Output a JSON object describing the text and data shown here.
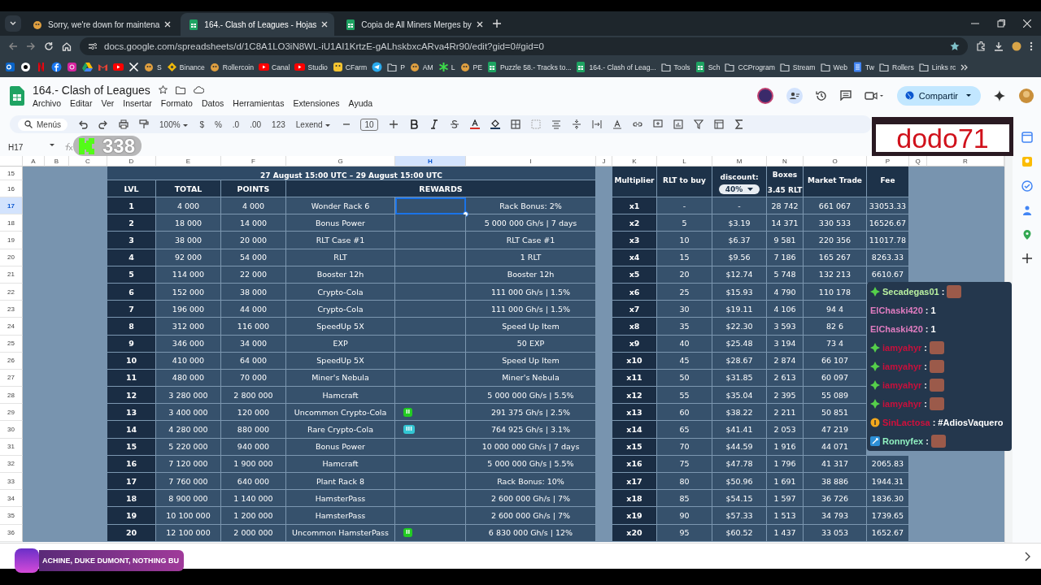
{
  "browser": {
    "tabs": [
      {
        "title": "Sorry, we're down for maintena",
        "kind": "mascot",
        "selected": false
      },
      {
        "title": "164.- Clash of Leagues - Hojas",
        "kind": "sheet",
        "selected": true
      },
      {
        "title": "Copia de All Miners Merges by",
        "kind": "sheet",
        "selected": false
      }
    ],
    "url": "docs.google.com/spreadsheets/d/1C8A1LO3iN8WL-iU1AI1KrtzE-gALhskbxcARva4Rr90/edit?gid=0#gid=0",
    "bookmarks": [
      {
        "kind": "outlook"
      },
      {
        "kind": "ring"
      },
      {
        "kind": "netflix"
      },
      {
        "kind": "facebook"
      },
      {
        "kind": "instagram"
      },
      {
        "kind": "drive"
      },
      {
        "kind": "gmail"
      },
      {
        "kind": "youtube"
      },
      {
        "kind": "x"
      },
      {
        "kind": "mascot",
        "label": "S"
      },
      {
        "kind": "diamond",
        "label": "Binance"
      },
      {
        "kind": "mascot",
        "label": "Rollercoin"
      },
      {
        "kind": "youtube",
        "label": "Canal"
      },
      {
        "kind": "youtube",
        "label": "Studio"
      },
      {
        "kind": "face",
        "label": "CFarm"
      },
      {
        "kind": "telegram"
      },
      {
        "kind": "folder",
        "label": "P"
      },
      {
        "kind": "mascot",
        "label": "AM"
      },
      {
        "kind": "star",
        "label": "L"
      },
      {
        "kind": "mascot",
        "label": "PE"
      },
      {
        "kind": "sheet",
        "label": "Puzzle 58.- Tracks to..."
      },
      {
        "kind": "sheet",
        "label": "164.- Clash of Leag..."
      },
      {
        "kind": "folder",
        "label": "Tools"
      },
      {
        "kind": "sheet",
        "label": "Sch"
      },
      {
        "kind": "folder",
        "label": "CCProgram"
      },
      {
        "kind": "folder",
        "label": "Stream"
      },
      {
        "kind": "folder",
        "label": "Web"
      },
      {
        "kind": "doc",
        "label": "Tw"
      },
      {
        "kind": "folder",
        "label": "Rollers"
      },
      {
        "kind": "folder",
        "label": "Links rc"
      }
    ]
  },
  "sheets": {
    "title": "164.- Clash of Leagues",
    "menus": [
      "Archivo",
      "Editar",
      "Ver",
      "Insertar",
      "Formato",
      "Datos",
      "Herramientas",
      "Extensiones",
      "Ayuda"
    ],
    "share_button": "Compartir",
    "search_menus": "Menús",
    "zoom": "100%",
    "currency": "$",
    "percent": "%",
    "decrease_decimals": ".0",
    "increase_decimals": ".00",
    "number_format": "123",
    "font": "Lexend",
    "font_size": "10",
    "cell_ref": "H17",
    "columns": [
      {
        "letter": "A",
        "selected": false
      },
      {
        "letter": "B",
        "selected": false
      },
      {
        "letter": "C",
        "selected": false
      },
      {
        "letter": "D",
        "selected": false
      },
      {
        "letter": "E",
        "selected": false
      },
      {
        "letter": "F",
        "selected": false
      },
      {
        "letter": "G",
        "selected": false
      },
      {
        "letter": "H",
        "selected": true
      },
      {
        "letter": "I",
        "selected": false
      },
      {
        "letter": "J",
        "selected": false
      },
      {
        "letter": "K",
        "selected": false
      },
      {
        "letter": "L",
        "selected": false
      },
      {
        "letter": "M",
        "selected": false
      },
      {
        "letter": "N",
        "selected": false
      },
      {
        "letter": "O",
        "selected": false
      },
      {
        "letter": "P",
        "selected": false
      },
      {
        "letter": "Q",
        "selected": false
      },
      {
        "letter": "R",
        "selected": false
      }
    ],
    "row_numbers": [
      {
        "label": "15",
        "selected": false
      },
      {
        "label": "16",
        "selected": false
      },
      {
        "label": "17",
        "selected": true
      },
      {
        "label": "18",
        "selected": false
      },
      {
        "label": "19",
        "selected": false
      },
      {
        "label": "20",
        "selected": false
      },
      {
        "label": "21",
        "selected": false
      },
      {
        "label": "22",
        "selected": false
      },
      {
        "label": "23",
        "selected": false
      },
      {
        "label": "24",
        "selected": false
      },
      {
        "label": "25",
        "selected": false
      },
      {
        "label": "26",
        "selected": false
      },
      {
        "label": "27",
        "selected": false
      },
      {
        "label": "28",
        "selected": false
      },
      {
        "label": "29",
        "selected": false
      },
      {
        "label": "30",
        "selected": false
      },
      {
        "label": "31",
        "selected": false
      },
      {
        "label": "32",
        "selected": false
      },
      {
        "label": "33",
        "selected": false
      },
      {
        "label": "34",
        "selected": false
      },
      {
        "label": "35",
        "selected": false
      },
      {
        "label": "36",
        "selected": false
      }
    ]
  },
  "levels_table": {
    "title": "27 August 15:00 UTC – 29 August 15:00 UTC",
    "headers": [
      "LVL",
      "TOTAL",
      "POINTS",
      "REWARDS"
    ],
    "rows": [
      {
        "lvl": "1",
        "total": "4 000",
        "points": "4 000",
        "reward": "Wonder Rack 6",
        "detail": "Rack Bonus: 2%",
        "selected": true
      },
      {
        "lvl": "2",
        "total": "18 000",
        "points": "14 000",
        "reward": "Bonus Power",
        "detail": "5 000 000 Gh/s | 7 days",
        "selected": false
      },
      {
        "lvl": "3",
        "total": "38 000",
        "points": "20 000",
        "reward": "RLT Case #1",
        "detail": "RLT Case #1",
        "selected": false
      },
      {
        "lvl": "4",
        "total": "92 000",
        "points": "54 000",
        "reward": "RLT",
        "detail": "1 RLT",
        "selected": false
      },
      {
        "lvl": "5",
        "total": "114 000",
        "points": "22 000",
        "reward": "Booster 12h",
        "detail": "Booster 12h",
        "selected": false
      },
      {
        "lvl": "6",
        "total": "152 000",
        "points": "38 000",
        "reward": "Crypto-Cola",
        "detail": "111 000 Gh/s  |  1.5%",
        "selected": false
      },
      {
        "lvl": "7",
        "total": "196 000",
        "points": "44 000",
        "reward": "Crypto-Cola",
        "detail": "111 000 Gh/s  |  1.5%",
        "selected": false
      },
      {
        "lvl": "8",
        "total": "312 000",
        "points": "116 000",
        "reward": "SpeedUp 5X",
        "detail": "Speed Up Item",
        "selected": false
      },
      {
        "lvl": "9",
        "total": "346 000",
        "points": "34 000",
        "reward": "EXP",
        "detail": "50 EXP",
        "selected": false
      },
      {
        "lvl": "10",
        "total": "410 000",
        "points": "64 000",
        "reward": "SpeedUp 5X",
        "detail": "Speed Up Item",
        "selected": false
      },
      {
        "lvl": "11",
        "total": "480 000",
        "points": "70 000",
        "reward": "Miner's Nebula",
        "detail": "Miner's Nebula",
        "selected": false
      },
      {
        "lvl": "12",
        "total": "3 280 000",
        "points": "2 800 000",
        "reward": "Hamcraft",
        "detail": "5 000 000 Gh/s  |  5.5%",
        "selected": false
      },
      {
        "lvl": "13",
        "total": "3 400 000",
        "points": "120 000",
        "reward": "Uncommon Crypto-Cola",
        "badge": {
          "label": "II",
          "color": "#22cc22"
        },
        "detail": "291 375 Gh/s  |  2.5%",
        "selected": false
      },
      {
        "lvl": "14",
        "total": "4 280 000",
        "points": "880 000",
        "reward": "Rare Crypto-Cola",
        "badge": {
          "label": "III",
          "color": "#33c6d3"
        },
        "detail": "764 925 Gh/s  |  3.1%",
        "selected": false
      },
      {
        "lvl": "15",
        "total": "5 220 000",
        "points": "940 000",
        "reward": "Bonus Power",
        "detail": "10 000 000 Gh/s | 7 days",
        "selected": false
      },
      {
        "lvl": "16",
        "total": "7 120 000",
        "points": "1 900 000",
        "reward": "Hamcraft",
        "detail": "5 000 000 Gh/s  |  5.5%",
        "selected": false
      },
      {
        "lvl": "17",
        "total": "7 760 000",
        "points": "640 000",
        "reward": "Plant Rack 8",
        "detail": "Rack Bonus: 10%",
        "selected": false
      },
      {
        "lvl": "18",
        "total": "8 900 000",
        "points": "1 140 000",
        "reward": "HamsterPass",
        "detail": "2 600 000 Gh/s  |  7%",
        "selected": false
      },
      {
        "lvl": "19",
        "total": "10 100 000",
        "points": "1 200 000",
        "reward": "HamsterPass",
        "detail": "2 600 000 Gh/s  |  7%",
        "selected": false
      },
      {
        "lvl": "20",
        "total": "12 100 000",
        "points": "2 000 000",
        "reward": "Uncommon HamsterPass",
        "badge": {
          "label": "II",
          "color": "#22cc22"
        },
        "detail": "6 830 000 Gh/s  |  12%",
        "selected": false
      }
    ]
  },
  "boxes_table": {
    "headers": [
      "Multiplier",
      "RLT to buy",
      "discount:",
      "Boxes",
      "Market Trade",
      "Fee"
    ],
    "discount": "40%",
    "box_price": "3.45 RLT",
    "rows": [
      {
        "multiplier": "x1",
        "rlt": "-",
        "price": "-",
        "boxes": "28 742",
        "market": "661 067",
        "fee": "33053.33"
      },
      {
        "multiplier": "x2",
        "rlt": "5",
        "price": "$3.19",
        "boxes": "14 371",
        "market": "330 533",
        "fee": "16526.67"
      },
      {
        "multiplier": "x3",
        "rlt": "10",
        "price": "$6.37",
        "boxes": "9 581",
        "market": "220 356",
        "fee": "11017.78"
      },
      {
        "multiplier": "x4",
        "rlt": "15",
        "price": "$9.56",
        "boxes": "7 186",
        "market": "165 267",
        "fee": "8263.33"
      },
      {
        "multiplier": "x5",
        "rlt": "20",
        "price": "$12.74",
        "boxes": "5 748",
        "market": "132 213",
        "fee": "6610.67"
      },
      {
        "multiplier": "x6",
        "rlt": "25",
        "price": "$15.93",
        "boxes": "4 790",
        "market": "110 178"
      },
      {
        "multiplier": "x7",
        "rlt": "30",
        "price": "$19.11",
        "boxes": "4 106",
        "market": "94 4"
      },
      {
        "multiplier": "x8",
        "rlt": "35",
        "price": "$22.30",
        "boxes": "3 593",
        "market": "82 6"
      },
      {
        "multiplier": "x9",
        "rlt": "40",
        "price": "$25.48",
        "boxes": "3 194",
        "market": "73 4"
      },
      {
        "multiplier": "x10",
        "rlt": "45",
        "price": "$28.67",
        "boxes": "2 874",
        "market": "66 107"
      },
      {
        "multiplier": "x11",
        "rlt": "50",
        "price": "$31.85",
        "boxes": "2 613",
        "market": "60 097"
      },
      {
        "multiplier": "x12",
        "rlt": "55",
        "price": "$35.04",
        "boxes": "2 395",
        "market": "55 089"
      },
      {
        "multiplier": "x13",
        "rlt": "60",
        "price": "$38.22",
        "boxes": "2 211",
        "market": "50 851"
      },
      {
        "multiplier": "x14",
        "rlt": "65",
        "price": "$41.41",
        "boxes": "2 053",
        "market": "47 219"
      },
      {
        "multiplier": "x15",
        "rlt": "70",
        "price": "$44.59",
        "boxes": "1 916",
        "market": "44 071"
      },
      {
        "multiplier": "x16",
        "rlt": "75",
        "price": "$47.78",
        "boxes": "1 796",
        "market": "41 317",
        "fee": "2065.83"
      },
      {
        "multiplier": "x17",
        "rlt": "80",
        "price": "$50.96",
        "boxes": "1 691",
        "market": "38 886",
        "fee": "1944.31"
      },
      {
        "multiplier": "x18",
        "rlt": "85",
        "price": "$54.15",
        "boxes": "1 597",
        "market": "36 726",
        "fee": "1836.30"
      },
      {
        "multiplier": "x19",
        "rlt": "90",
        "price": "$57.33",
        "boxes": "1 513",
        "market": "34 793",
        "fee": "1739.65"
      },
      {
        "multiplier": "x20",
        "rlt": "95",
        "price": "$60.52",
        "boxes": "1 437",
        "market": "33 053",
        "fee": "1652.67"
      }
    ]
  },
  "stream_overlay": {
    "follower_count": "338",
    "streamer_name": "dodo71",
    "now_playing": "ACHINE, DUKE DUMONT, NOTHING BU",
    "chat": [
      {
        "kind": "gem",
        "user": "Secadegas01",
        "color": "#b9f0a0",
        "separator": ":",
        "emote": true
      },
      {
        "kind": "plain",
        "user": "ElChaski420",
        "color": "#e07cc0",
        "separator": ":",
        "message": "1"
      },
      {
        "kind": "plain",
        "user": "ElChaski420",
        "color": "#e07cc0",
        "separator": ":",
        "message": "1"
      },
      {
        "kind": "gem",
        "user": "iamyahyr",
        "color": "#c8103c",
        "separator": ":",
        "emote": true
      },
      {
        "kind": "gem",
        "user": "iamyahyr",
        "color": "#c8103c",
        "separator": ":",
        "emote": true
      },
      {
        "kind": "gem",
        "user": "iamyahyr",
        "color": "#c8103c",
        "separator": ":",
        "emote": true
      },
      {
        "kind": "gem",
        "user": "iamyahyr",
        "color": "#c8103c",
        "separator": ":",
        "emote": true
      },
      {
        "kind": "coin",
        "user": "SinLactosa",
        "color": "#d0103c",
        "separator": ":",
        "message": "#AdiosVaquero"
      },
      {
        "kind": "tools",
        "user": "Ronnyfex",
        "color": "#90f0c0",
        "separator": ":",
        "emote": true
      }
    ]
  }
}
